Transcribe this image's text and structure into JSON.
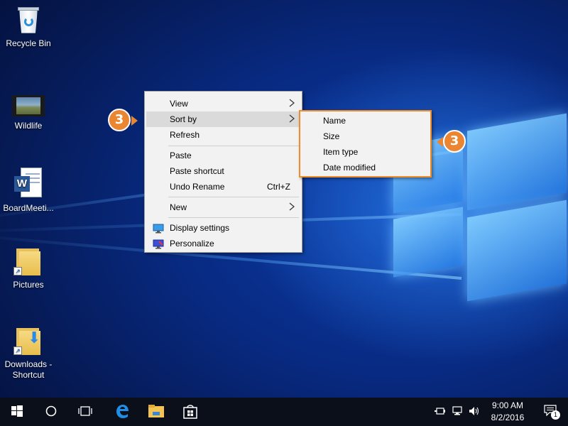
{
  "desktop": {
    "icons": [
      {
        "label": "Recycle Bin",
        "icon": "recycle-bin-icon"
      },
      {
        "label": "Wildlife",
        "icon": "video-file-icon"
      },
      {
        "label": "BoardMeeti...",
        "icon": "word-document-icon"
      },
      {
        "label": "Pictures",
        "icon": "folder-shortcut-icon"
      },
      {
        "label": "Downloads -",
        "label2": "Shortcut",
        "icon": "downloads-shortcut-icon"
      }
    ]
  },
  "context_menu": {
    "items": {
      "view": "View",
      "sort_by": "Sort by",
      "refresh": "Refresh",
      "paste": "Paste",
      "paste_shortcut": "Paste shortcut",
      "undo_rename": "Undo Rename",
      "undo_rename_shortcut": "Ctrl+Z",
      "new": "New",
      "display_settings": "Display settings",
      "personalize": "Personalize"
    },
    "highlighted": "Sort by",
    "submenu_arrow": ">"
  },
  "sort_submenu": {
    "items": [
      "Name",
      "Size",
      "Item type",
      "Date modified"
    ]
  },
  "callouts": {
    "step_left": "3",
    "step_right": "3",
    "color": "#ea8632"
  },
  "taskbar": {
    "buttons": [
      "start-icon",
      "search-circle-icon",
      "task-view-icon",
      "edge-icon",
      "file-explorer-icon",
      "store-icon"
    ],
    "clock": {
      "time": "9:00 AM",
      "date": "8/2/2016"
    },
    "notification_count": "1"
  },
  "colors": {
    "accent_orange": "#f08c2c",
    "menu_bg": "#f2f2f2",
    "taskbar_bg": "#0b0f19"
  }
}
